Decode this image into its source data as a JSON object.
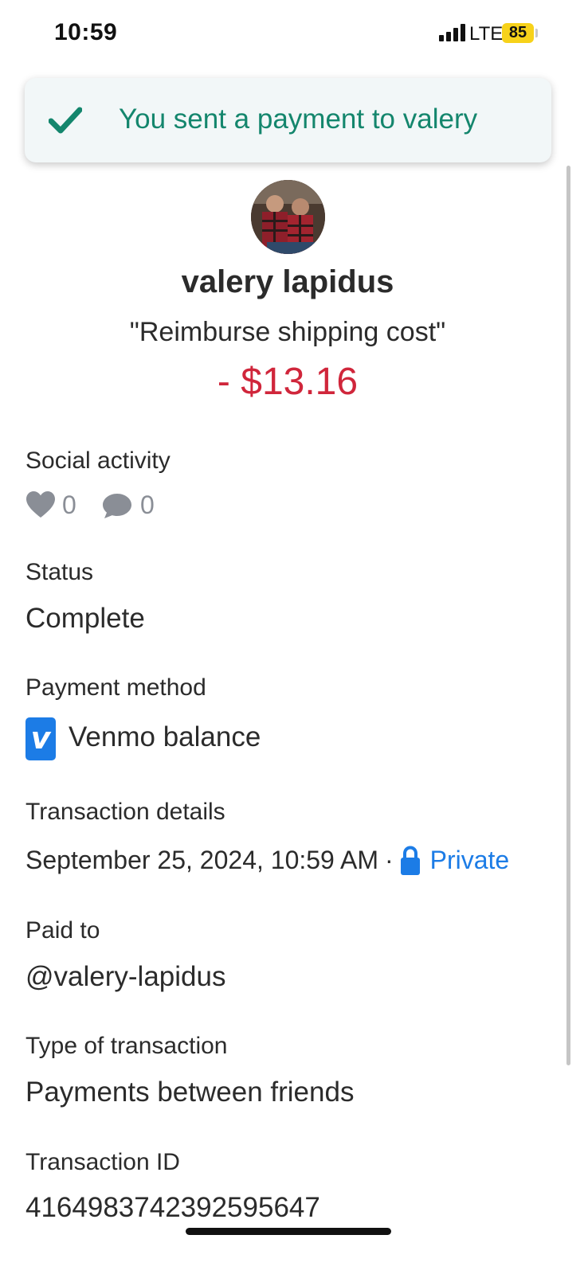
{
  "status_bar": {
    "time": "10:59",
    "network": "LTE",
    "battery": "85"
  },
  "toast": {
    "message": "You sent a payment to valery",
    "icon": "checkmark-icon",
    "color": "#14866d"
  },
  "header": {
    "name": "valery lapidus",
    "note": "\"Reimburse shipping cost\"",
    "amount": "- $13.16",
    "amount_color": "#d0263b"
  },
  "social": {
    "label": "Social activity",
    "likes": "0",
    "comments": "0"
  },
  "status": {
    "label": "Status",
    "value": "Complete"
  },
  "payment_method": {
    "label": "Payment method",
    "logo_letter": "v",
    "value": "Venmo balance"
  },
  "transaction_details": {
    "label": "Transaction details",
    "date": "September 25, 2024, 10:59 AM",
    "separator": "·",
    "privacy": "Private",
    "accent": "#1c7ce6"
  },
  "paid_to": {
    "label": "Paid to",
    "value": "@valery-lapidus"
  },
  "type": {
    "label": "Type of transaction",
    "value": "Payments between friends"
  },
  "transaction_id": {
    "label": "Transaction ID",
    "value": "4164983742392595647"
  }
}
